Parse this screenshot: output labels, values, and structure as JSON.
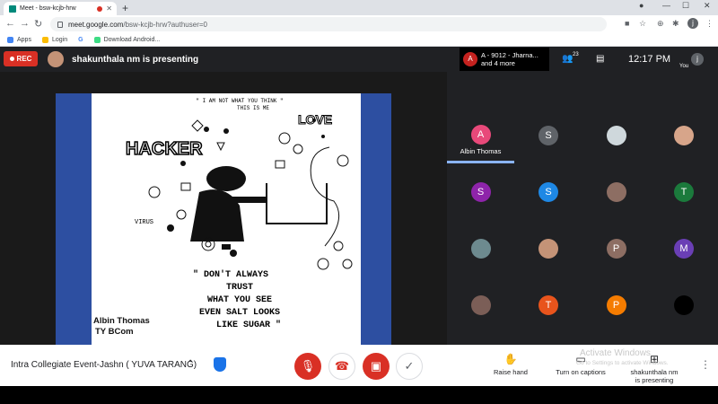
{
  "browser": {
    "tab_title": "Meet - bsw-kcjb-hrw",
    "url_host": "meet.google.com",
    "url_path": "/bsw-kcjb-hrw?authuser=0",
    "profile_initial": "j",
    "bookmarks": [
      "Apps",
      "Login",
      "Download Android..."
    ]
  },
  "meet": {
    "rec_label": "REC",
    "presenting_text": "shakunthala nm is presenting",
    "notification": {
      "initial": "A",
      "line1": "A - 9012 - Jharna...",
      "line2": "and 4 more"
    },
    "participant_count": "23",
    "time": "12:17 PM",
    "you_label": "You",
    "you_initial": "j"
  },
  "slide": {
    "caption_top": "\" I AM NOT WHAT YOU THINK \"",
    "caption_top2": "THIS IS ME",
    "hacker": "HACKER",
    "love": "LOVE",
    "virus": "VIRUS",
    "quote": [
      "\" DON'T ALWAYS",
      "TRUST",
      "WHAT YOU SEE",
      "EVEN SALT LOOKS",
      "LIKE SUGAR \""
    ],
    "author_name": "Albin Thomas",
    "author_class": "TY BCom"
  },
  "participants": [
    {
      "initial": "A",
      "color": "#e8497a",
      "label": "Albin Thomas",
      "active": true
    },
    {
      "initial": "S",
      "color": "#5f6368"
    },
    {
      "initial": "",
      "color": "#cfd8dc",
      "photo": true
    },
    {
      "initial": "",
      "color": "#d7a58a",
      "photo": true
    },
    {
      "initial": "S",
      "color": "#8e24aa"
    },
    {
      "initial": "S",
      "color": "#1e88e5"
    },
    {
      "initial": "",
      "color": "#8d6e63",
      "photo": true
    },
    {
      "initial": "T",
      "color": "#1b7a3c"
    },
    {
      "initial": "",
      "color": "#6d8a8f",
      "photo": true
    },
    {
      "initial": "",
      "color": "#c49377",
      "photo": true
    },
    {
      "initial": "P",
      "color": "#8d6e63"
    },
    {
      "initial": "M",
      "color": "#6a3fb5"
    },
    {
      "initial": "",
      "color": "#7b5e57",
      "photo": true
    },
    {
      "initial": "T",
      "color": "#e8541c"
    },
    {
      "initial": "P",
      "color": "#f57c00"
    },
    {
      "initial": "",
      "color": "#000000"
    }
  ],
  "bottom": {
    "meeting_title": "Intra Collegiate Event-Jashn ( YUVA TARANG)",
    "raise_hand": "Raise hand",
    "captions": "Turn on captions",
    "presenting_line1": "shakunthala nm",
    "presenting_line2": "is presenting",
    "watermark1": "Activate Windows",
    "watermark2": "Go to Settings to activate Windows."
  }
}
